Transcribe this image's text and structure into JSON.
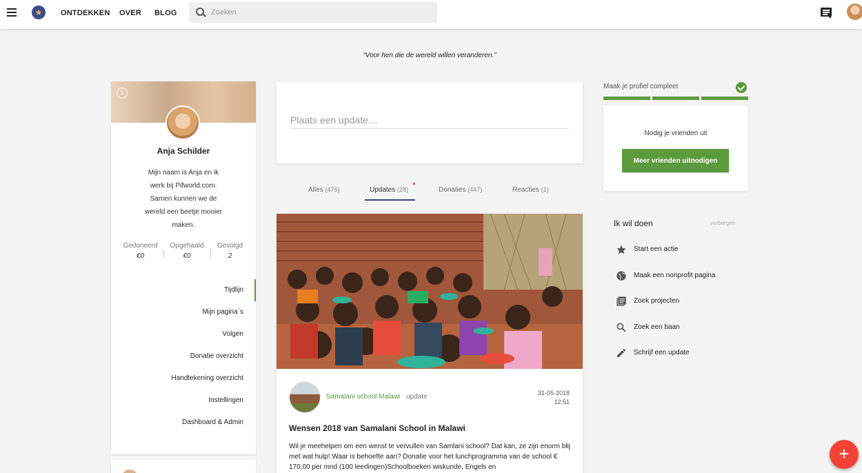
{
  "nav": {
    "links": [
      "ONTDEKKEN",
      "OVER",
      "BLOG"
    ],
    "search_placeholder": "Zoeken"
  },
  "quote": "“Voor hen die de wereld willen veranderen.”",
  "profile": {
    "name": "Anja Schilder",
    "bio": "Mijn naam is Anja en ik werk bij Pifworld.com. Samen kunnen we de wereld een beetje mooier maken.",
    "stats": [
      {
        "label": "Gedoneerd",
        "value": "€0"
      },
      {
        "label": "Opgehaald",
        "value": "€0"
      },
      {
        "label": "Gevolgd",
        "value": "2"
      }
    ],
    "menu": [
      "Tijdlijn",
      "Mijn pagina`s",
      "Volgen",
      "Donatie overzicht",
      "Handtekening overzicht",
      "Instellingen",
      "Dashboard & Admin"
    ],
    "active_menu": "Tijdlijn"
  },
  "composer": {
    "placeholder": "Plaats een update…"
  },
  "tabs": [
    {
      "label": "Alles",
      "count": "(476)"
    },
    {
      "label": "Updates",
      "count": "(28)"
    },
    {
      "label": "Donaties",
      "count": "(447)"
    },
    {
      "label": "Reacties",
      "count": "(1)"
    }
  ],
  "active_tab": "Updates",
  "post": {
    "org": "Samalani school Malawi",
    "type": "update",
    "date": "31-05-2018",
    "time": "12:51",
    "title": "Wensen 2018 van Samalani School in Malawi",
    "body": "Wil je meehelpen om een wenst te vervullen van Samlani school?  Dat kan, ze zijn enorm blij met wat hulp!  Waar is behoefte aan? Donatie voor het lunchprogramma van de school € 170,00 per mnd (100 leerlingen)Schoolboeken wiskunde, Engels en"
  },
  "completion": {
    "label": "Maak je profiel compleet",
    "segments_filled": 3,
    "segments_total": 3
  },
  "invite": {
    "text": "Nodig je vrienden uit",
    "button": "Meer vrienden uitnodigen"
  },
  "actions": {
    "title": "Ik wil doen",
    "hide": "verbergen",
    "items": [
      {
        "label": "Start een actie",
        "icon": "star-icon"
      },
      {
        "label": "Maak een nonprofit pagina",
        "icon": "globe-icon"
      },
      {
        "label": "Zoek projecten",
        "icon": "list-icon"
      },
      {
        "label": "Zoek een baan",
        "icon": "search-icon"
      },
      {
        "label": "Schrijf een update",
        "icon": "pencil-icon"
      }
    ]
  },
  "colors": {
    "accent_green": "#5c9a3e",
    "fab_red": "#f44336",
    "nav_dark": "#222222"
  },
  "fab_label": "+"
}
